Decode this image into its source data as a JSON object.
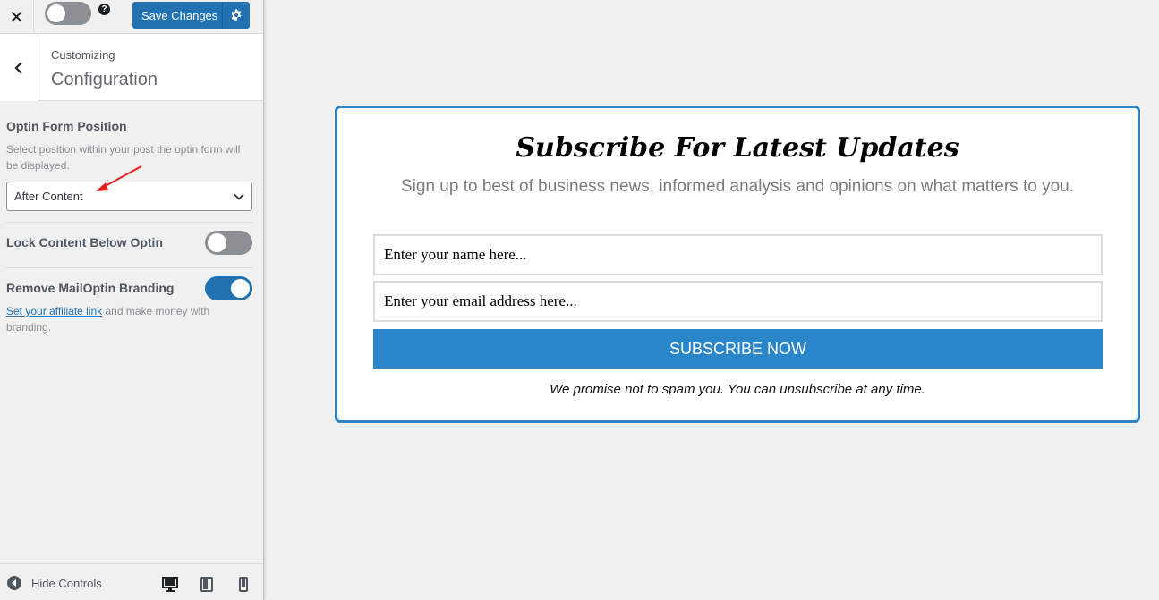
{
  "topbar": {
    "close_symbol": "✕",
    "save_label": "Save Changes",
    "help_symbol": "?"
  },
  "section": {
    "breadcrumb": "Customizing",
    "title": "Configuration"
  },
  "controls": {
    "position": {
      "label": "Optin Form Position",
      "description": "Select position within your post the optin form will be displayed.",
      "selected": "After Content"
    },
    "lock": {
      "label": "Lock Content Below Optin",
      "enabled": false
    },
    "branding": {
      "label": "Remove MailOptin Branding",
      "enabled": true,
      "link_text": "Set your affiliate link",
      "desc_rest": " and make money with branding."
    }
  },
  "footer": {
    "hide_controls": "Hide Controls"
  },
  "optin": {
    "headline": "Subscribe For Latest Updates",
    "subheadline": "Sign up to best of business news, informed analysis and opinions on what matters to you.",
    "name_placeholder": "Enter your name here...",
    "email_placeholder": "Enter your email address here...",
    "button_label": "SUBSCRIBE NOW",
    "note": "We promise not to spam you. You can unsubscribe at any time."
  },
  "colors": {
    "accent": "#2271b1",
    "optin_border": "#2f84c8",
    "optin_button": "#2b86c9",
    "annotation_arrow": "#e02020"
  },
  "icons": [
    "close-icon",
    "help-icon",
    "gear-icon",
    "chevron-left-icon",
    "chevron-down-icon",
    "arrow-left-circle-icon",
    "desktop-icon",
    "tablet-icon",
    "mobile-icon"
  ]
}
